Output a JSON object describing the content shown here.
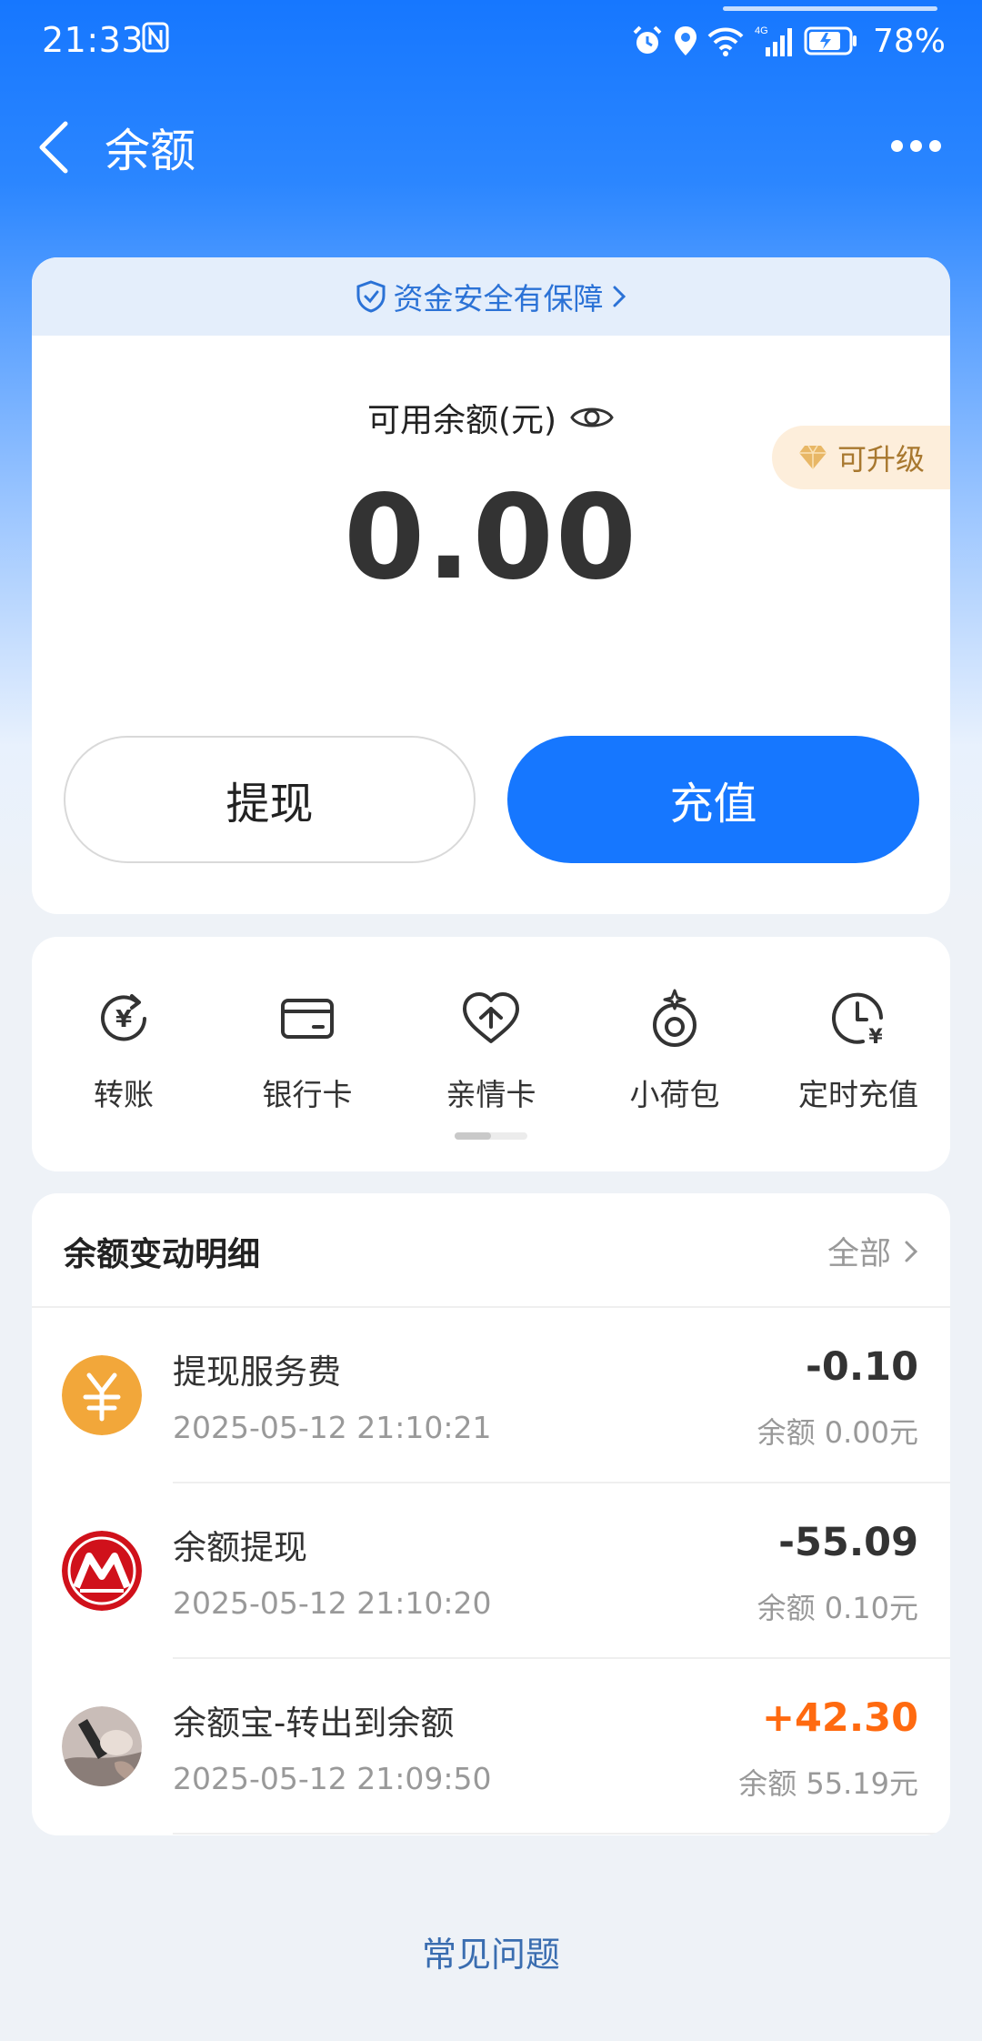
{
  "status_bar": {
    "time": "21:33",
    "network": "4G",
    "battery": "78%"
  },
  "nav": {
    "title": "余额"
  },
  "balance_card": {
    "security_text": "资金安全有保障",
    "balance_label": "可用余额(元)",
    "upgrade_badge": "可升级",
    "amount": "0.00",
    "withdraw_label": "提现",
    "recharge_label": "充值"
  },
  "actions": [
    {
      "label": "转账",
      "icon": "transfer-icon"
    },
    {
      "label": "银行卡",
      "icon": "bank-card-icon"
    },
    {
      "label": "亲情卡",
      "icon": "family-card-icon"
    },
    {
      "label": "小荷包",
      "icon": "small-purse-icon"
    },
    {
      "label": "定时充值",
      "icon": "scheduled-recharge-icon"
    }
  ],
  "transactions": {
    "title": "余额变动明细",
    "all_label": "全部",
    "items": [
      {
        "name": "提现服务费",
        "time": "2025-05-12 21:10:21",
        "amount": "-0.10",
        "balance": "余额 0.00元",
        "icon": "yuan-coin-icon"
      },
      {
        "name": "余额提现",
        "time": "2025-05-12 21:10:20",
        "amount": "-55.09",
        "balance": "余额 0.10元",
        "icon": "cmb-bank-logo-icon"
      },
      {
        "name": "余额宝-转出到余额",
        "time": "2025-05-12 21:09:50",
        "amount": "+42.30",
        "balance": "余额 55.19元",
        "icon": "user-avatar-icon"
      }
    ]
  },
  "footer": {
    "faq_label": "常见问题"
  },
  "colors": {
    "primary": "#1677ff",
    "positive_amount": "#ff6a10",
    "upgrade_badge_bg": "#fdeedb",
    "upgrade_badge_text": "#a8782f"
  }
}
